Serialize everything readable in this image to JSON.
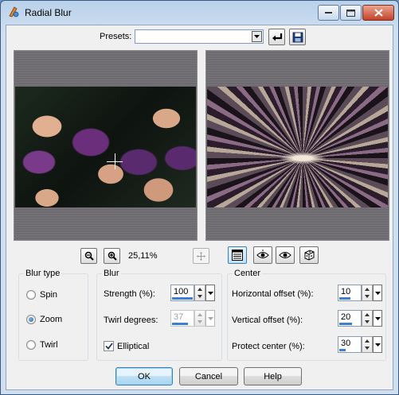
{
  "window": {
    "title": "Radial Blur"
  },
  "presets": {
    "label": "Presets:",
    "value": ""
  },
  "preview": {
    "zoom_label": "25,11%"
  },
  "blur_type": {
    "title": "Blur type",
    "options": [
      {
        "label": "Spin",
        "checked": false
      },
      {
        "label": "Zoom",
        "checked": true
      },
      {
        "label": "Twirl",
        "checked": false
      }
    ]
  },
  "blur": {
    "title": "Blur",
    "strength_label": "Strength (%):",
    "strength_value": "100",
    "strength_fill": 1.0,
    "twirl_label": "Twirl degrees:",
    "twirl_value": "37",
    "twirl_fill": 0.75,
    "elliptical_label": "Elliptical",
    "elliptical_checked": true
  },
  "center": {
    "title": "Center",
    "h_offset_label": "Horizontal offset (%):",
    "h_offset_value": "10",
    "h_offset_fill": 0.55,
    "v_offset_label": "Vertical offset (%):",
    "v_offset_value": "20",
    "v_offset_fill": 0.6,
    "protect_label": "Protect center (%):",
    "protect_value": "30",
    "protect_fill": 0.3
  },
  "buttons": {
    "ok": "OK",
    "cancel": "Cancel",
    "help": "Help"
  },
  "colors": {
    "accent": "#3d7fd6",
    "title_bar": "#b9d1ea",
    "close": "#c4432a"
  }
}
